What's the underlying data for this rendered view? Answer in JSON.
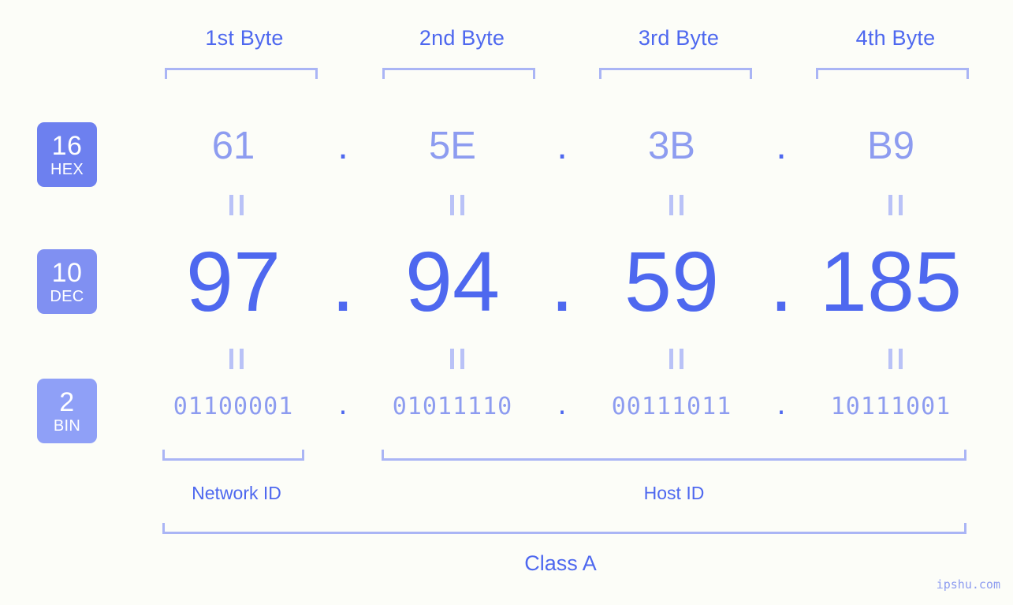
{
  "background_color": "#fcfdf8",
  "colors": {
    "accent_strong": "#4e68ef",
    "accent_light": "#8d9cf0",
    "bracket": "#aab5f5",
    "equals": "#b9c2f7",
    "badge_hex": "#6d80ef",
    "badge_dec": "#8090f2",
    "badge_bin": "#8fa0f7"
  },
  "byte_headers": [
    {
      "label": "1st Byte"
    },
    {
      "label": "2nd Byte"
    },
    {
      "label": "3rd Byte"
    },
    {
      "label": "4th Byte"
    }
  ],
  "bases": [
    {
      "number": "16",
      "name": "HEX"
    },
    {
      "number": "10",
      "name": "DEC"
    },
    {
      "number": "2",
      "name": "BIN"
    }
  ],
  "separator": ".",
  "rows": {
    "hex": {
      "values": [
        "61",
        "5E",
        "3B",
        "B9"
      ]
    },
    "dec": {
      "values": [
        "97",
        "94",
        "59",
        "185"
      ]
    },
    "bin": {
      "values": [
        "01100001",
        "01011110",
        "00111011",
        "10111001"
      ]
    }
  },
  "id_sections": [
    {
      "label": "Network ID"
    },
    {
      "label": "Host ID"
    }
  ],
  "class_label": "Class A",
  "watermark": "ipshu.com"
}
